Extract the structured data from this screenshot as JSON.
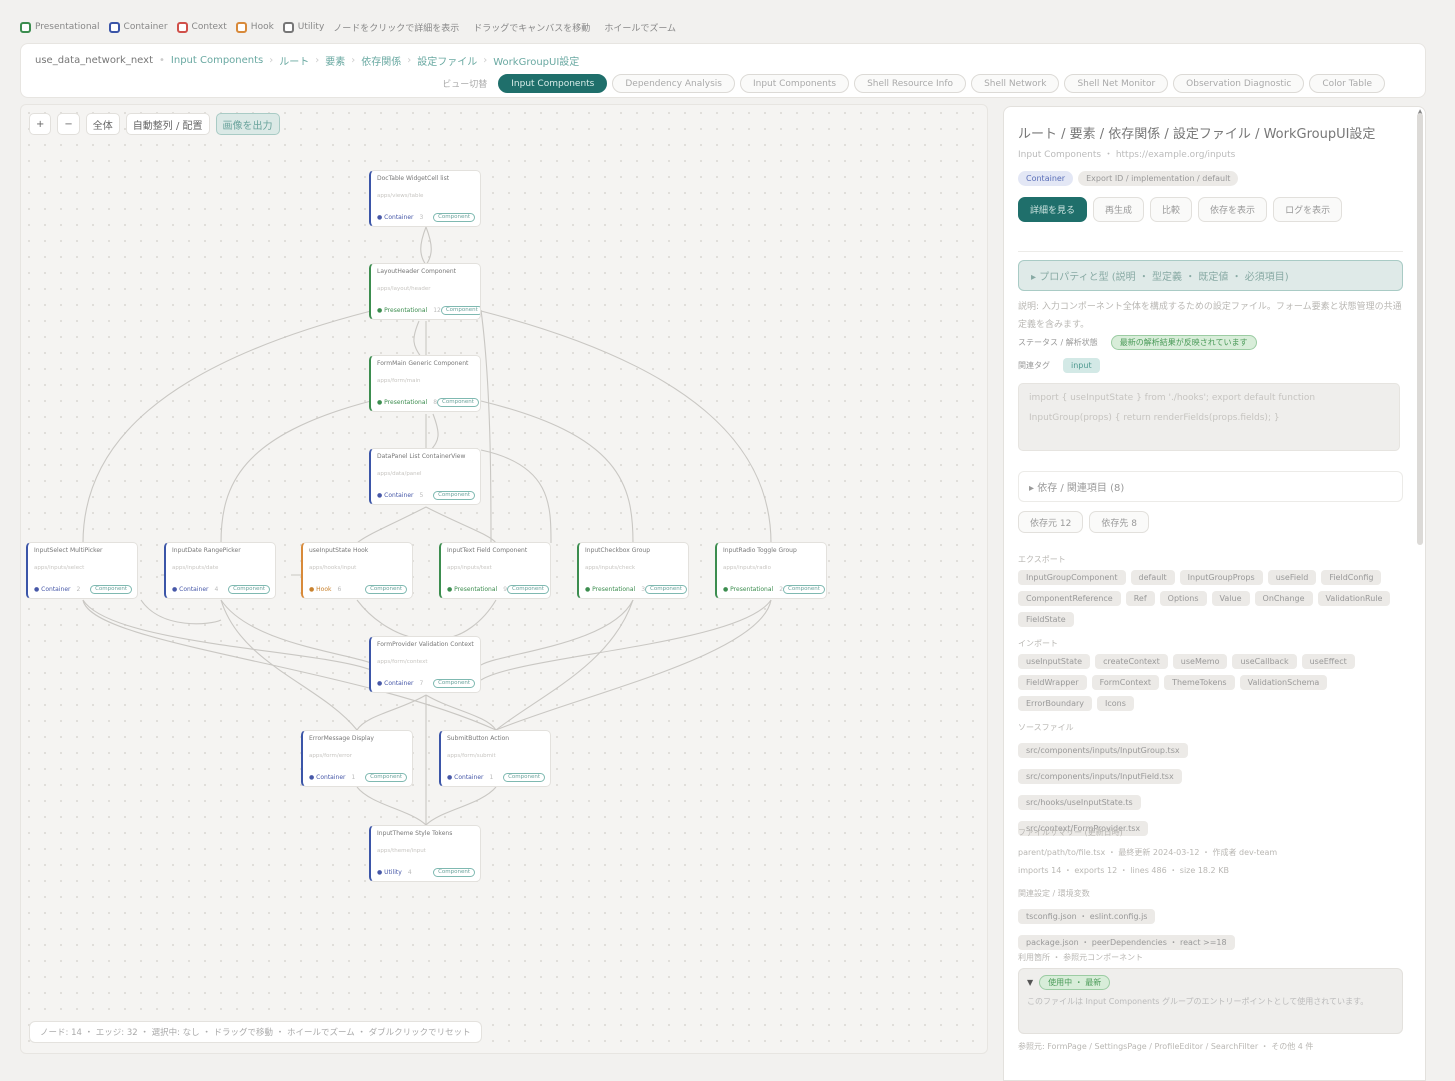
{
  "legend": [
    {
      "color": "#3c8d4f",
      "label": "Presentational"
    },
    {
      "color": "#3b55a8",
      "label": "Container"
    },
    {
      "color": "#d0504a",
      "label": "Context"
    },
    {
      "color": "#d88a3a",
      "label": "Hook"
    },
    {
      "color": "#777777",
      "label": "Utility"
    }
  ],
  "legend_notes": [
    "ノードをクリックで詳細を表示",
    "ドラッグでキャンバスを移動",
    "ホイールでズーム"
  ],
  "breadcrumbs": {
    "items": [
      "use_data_network_next",
      "Input Components",
      "ルート",
      "要素",
      "依存関係",
      "設定ファイル",
      "WorkGroupUI設定"
    ]
  },
  "tabs": {
    "label": "ビュー切替",
    "items": [
      "Input Components",
      "Dependency Analysis",
      "Input Components",
      "Shell Resource Info",
      "Shell Network",
      "Shell Net Monitor",
      "Observation Diagnostic",
      "Color Table"
    ],
    "active_index": 0
  },
  "toolbar": {
    "zoom_in": "+",
    "zoom_out": "−",
    "fit": "全体",
    "layout": "自動整列 / 配置",
    "export": "画像を出力"
  },
  "nodes": [
    {
      "title": "DocTable WidgetCell list",
      "subtitle": "apps/views/table",
      "kind": "Container",
      "count": "3",
      "badge": "Component",
      "type": "blue"
    },
    {
      "title": "LayoutHeader Component",
      "subtitle": "apps/layout/header",
      "kind": "Presentational",
      "count": "12",
      "badge": "Component",
      "type": "green"
    },
    {
      "title": "FormMain Generic Component",
      "subtitle": "apps/form/main",
      "kind": "Presentational",
      "count": "8",
      "badge": "Component",
      "type": "green"
    },
    {
      "title": "DataPanel List ContainerView",
      "subtitle": "apps/data/panel",
      "kind": "Container",
      "count": "5",
      "badge": "Component",
      "type": "blue"
    },
    {
      "title": "InputSelect MultiPicker",
      "subtitle": "apps/inputs/select",
      "kind": "Container",
      "count": "2",
      "badge": "Component",
      "type": "blue"
    },
    {
      "title": "InputDate RangePicker",
      "subtitle": "apps/inputs/date",
      "kind": "Container",
      "count": "4",
      "badge": "Component",
      "type": "blue"
    },
    {
      "title": "useInputState Hook",
      "subtitle": "apps/hooks/input",
      "kind": "Hook",
      "count": "6",
      "badge": "Component",
      "type": "orange"
    },
    {
      "title": "InputText Field Component",
      "subtitle": "apps/inputs/text",
      "kind": "Presentational",
      "count": "9",
      "badge": "Component",
      "type": "green"
    },
    {
      "title": "InputCheckbox Group",
      "subtitle": "apps/inputs/check",
      "kind": "Presentational",
      "count": "3",
      "badge": "Component",
      "type": "green"
    },
    {
      "title": "InputRadio Toggle Group",
      "subtitle": "apps/inputs/radio",
      "kind": "Presentational",
      "count": "2",
      "badge": "Component",
      "type": "green"
    },
    {
      "title": "FormProvider Validation Context",
      "subtitle": "apps/form/context",
      "kind": "Container",
      "count": "7",
      "badge": "Component",
      "type": "blue"
    },
    {
      "title": "ErrorMessage Display",
      "subtitle": "apps/form/error",
      "kind": "Container",
      "count": "1",
      "badge": "Component",
      "type": "blue"
    },
    {
      "title": "SubmitButton Action",
      "subtitle": "apps/form/submit",
      "kind": "Container",
      "count": "1",
      "badge": "Component",
      "type": "blue"
    },
    {
      "title": "InputTheme Style Tokens",
      "subtitle": "apps/theme/input",
      "kind": "Utility",
      "count": "4",
      "badge": "Component",
      "type": "blue"
    }
  ],
  "status_bar": "ノード: 14 ・ エッジ: 32 ・ 選択中: なし ・ ドラッグで移動 ・ ホイールでズーム ・ ダブルクリックでリセット",
  "panel": {
    "title": "ルート / 要素 / 依存関係 / 設定ファイル / WorkGroupUI設定",
    "subtitle": "Input Components ・ https://example.org/inputs",
    "tag": "Container",
    "tag_desc": "Export ID / implementation / default",
    "actions": [
      "詳細を見る",
      "再生成",
      "比較",
      "依存を表示",
      "ログを表示"
    ],
    "active_action": 0,
    "accordion1": "▸ プロパティと型 (説明 ・ 型定義 ・ 既定値 ・ 必須項目)",
    "desc_line": "説明: 入力コンポーネント全体を構成するための設定ファイル。フォーム要素と状態管理の共通定義を含みます。",
    "status_label": "ステータス / 解析状態",
    "status_value": "最新の解析結果が反映されています",
    "tag_label": "関連タグ",
    "tag_value": "input",
    "code_text": "import { useInputState } from './hooks'; export default function InputGroup(props) { return renderFields(props.fields); }",
    "accordion2": "▸ 依存 / 関連項目 (8)",
    "chips1": [
      "依存元 12",
      "依存先 8"
    ],
    "section_exports": "エクスポート",
    "exports": [
      "InputGroupComponent",
      "default",
      "InputGroupProps",
      "useField",
      "FieldConfig",
      "ComponentReference",
      "Ref",
      "Options",
      "Value",
      "OnChange",
      "ValidationRule",
      "FieldState"
    ],
    "section_imports": "インポート",
    "imports": [
      "useInputState",
      "createContext",
      "useMemo",
      "useCallback",
      "useEffect",
      "FieldWrapper",
      "FormContext",
      "ThemeTokens",
      "ValidationSchema",
      "ErrorBoundary",
      "Icons"
    ],
    "section_sources": "ソースファイル",
    "sources": [
      "src/components/inputs/InputGroup.tsx",
      "src/components/inputs/InputField.tsx",
      "src/hooks/useInputState.ts",
      "src/context/FormProvider.tsx"
    ],
    "section_summary": "ファイルサマリー (更新日時)",
    "summary_line1": "parent/path/to/file.tsx ・ 最終更新 2024-03-12 ・ 作成者 dev-team",
    "summary_line2": "imports 14 ・ exports 12 ・ lines 486 ・ size 18.2 KB",
    "section_related": "関連設定 / 環境変数",
    "related": [
      "tsconfig.json ・ eslint.config.js",
      "package.json ・ peerDependencies ・ react >=18"
    ],
    "section_trail": "利用箇所 ・ 参照元コンポーネント",
    "details_tag": "使用中 ・ 最新",
    "details_text": "このファイルは Input Components グループのエントリーポイントとして使用されています。",
    "footer_text": "参照元: FormPage / SettingsPage / ProfileEditor / SearchFilter ・ その他 4 件"
  }
}
